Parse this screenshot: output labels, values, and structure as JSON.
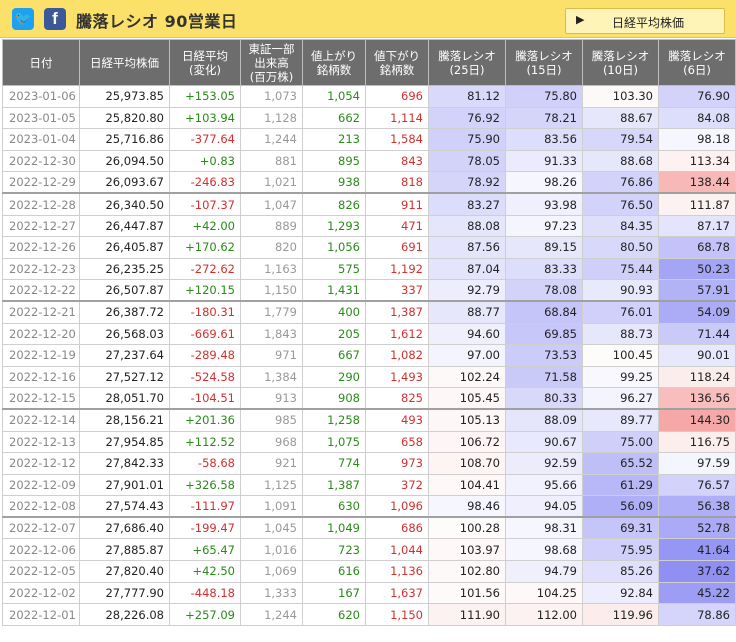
{
  "header": {
    "title": "騰落レシオ 90営業日",
    "nav_button": "日経平均株価",
    "nav_arrow": "▶",
    "twitter_glyph": "🐦",
    "facebook_glyph": "f"
  },
  "columns": [
    [
      "日付"
    ],
    [
      "日経平均株価"
    ],
    [
      "日経平均",
      "(変化)"
    ],
    [
      "東証一部",
      "出来高",
      "(百万株)"
    ],
    [
      "値上がり",
      "銘柄数"
    ],
    [
      "値下がり",
      "銘柄数"
    ],
    [
      "騰落レシオ",
      "(25日)"
    ],
    [
      "騰落レシオ",
      "(15日)"
    ],
    [
      "騰落レシオ",
      "(10日)"
    ],
    [
      "騰落レシオ",
      "(6日)"
    ]
  ],
  "rows": [
    [
      "2023-01-06",
      "25,973.85",
      "+153.05",
      "1,073",
      "1,054",
      "696",
      "81.12",
      "75.80",
      "103.30",
      "76.90"
    ],
    [
      "2023-01-05",
      "25,820.80",
      "+103.94",
      "1,128",
      "662",
      "1,114",
      "76.92",
      "78.21",
      "88.67",
      "84.08"
    ],
    [
      "2023-01-04",
      "25,716.86",
      "-377.64",
      "1,244",
      "213",
      "1,584",
      "75.90",
      "83.56",
      "79.54",
      "98.18"
    ],
    [
      "2022-12-30",
      "26,094.50",
      "+0.83",
      "881",
      "895",
      "843",
      "78.05",
      "91.33",
      "88.68",
      "113.34"
    ],
    [
      "2022-12-29",
      "26,093.67",
      "-246.83",
      "1,021",
      "938",
      "818",
      "78.92",
      "98.26",
      "76.86",
      "138.44"
    ],
    [
      "2022-12-28",
      "26,340.50",
      "-107.37",
      "1,047",
      "826",
      "911",
      "83.27",
      "93.98",
      "76.50",
      "111.87"
    ],
    [
      "2022-12-27",
      "26,447.87",
      "+42.00",
      "889",
      "1,293",
      "471",
      "88.08",
      "97.23",
      "84.35",
      "87.17"
    ],
    [
      "2022-12-26",
      "26,405.87",
      "+170.62",
      "820",
      "1,056",
      "691",
      "87.56",
      "89.15",
      "80.50",
      "68.78"
    ],
    [
      "2022-12-23",
      "26,235.25",
      "-272.62",
      "1,163",
      "575",
      "1,192",
      "87.04",
      "83.33",
      "75.44",
      "50.23"
    ],
    [
      "2022-12-22",
      "26,507.87",
      "+120.15",
      "1,150",
      "1,431",
      "337",
      "92.79",
      "78.08",
      "90.93",
      "57.91"
    ],
    [
      "2022-12-21",
      "26,387.72",
      "-180.31",
      "1,779",
      "400",
      "1,387",
      "88.77",
      "68.84",
      "76.01",
      "54.09"
    ],
    [
      "2022-12-20",
      "26,568.03",
      "-669.61",
      "1,843",
      "205",
      "1,612",
      "94.60",
      "69.85",
      "88.73",
      "71.44"
    ],
    [
      "2022-12-19",
      "27,237.64",
      "-289.48",
      "971",
      "667",
      "1,082",
      "97.00",
      "73.53",
      "100.45",
      "90.01"
    ],
    [
      "2022-12-16",
      "27,527.12",
      "-524.58",
      "1,384",
      "290",
      "1,493",
      "102.24",
      "71.58",
      "99.25",
      "118.24"
    ],
    [
      "2022-12-15",
      "28,051.70",
      "-104.51",
      "913",
      "908",
      "825",
      "105.45",
      "80.33",
      "96.27",
      "136.56"
    ],
    [
      "2022-12-14",
      "28,156.21",
      "+201.36",
      "985",
      "1,258",
      "493",
      "105.13",
      "88.09",
      "89.77",
      "144.30"
    ],
    [
      "2022-12-13",
      "27,954.85",
      "+112.52",
      "968",
      "1,075",
      "658",
      "106.72",
      "90.67",
      "75.00",
      "116.75"
    ],
    [
      "2022-12-12",
      "27,842.33",
      "-58.68",
      "921",
      "774",
      "973",
      "108.70",
      "92.59",
      "65.52",
      "97.59"
    ],
    [
      "2022-12-09",
      "27,901.01",
      "+326.58",
      "1,125",
      "1,387",
      "372",
      "104.41",
      "95.66",
      "61.29",
      "76.57"
    ],
    [
      "2022-12-08",
      "27,574.43",
      "-111.97",
      "1,091",
      "630",
      "1,096",
      "98.46",
      "94.05",
      "56.09",
      "56.38"
    ],
    [
      "2022-12-07",
      "27,686.40",
      "-199.47",
      "1,045",
      "1,049",
      "686",
      "100.28",
      "98.31",
      "69.31",
      "52.78"
    ],
    [
      "2022-12-06",
      "27,885.87",
      "+65.47",
      "1,016",
      "723",
      "1,044",
      "103.97",
      "98.68",
      "75.95",
      "41.64"
    ],
    [
      "2022-12-05",
      "27,820.40",
      "+42.50",
      "1,069",
      "616",
      "1,136",
      "102.80",
      "94.79",
      "85.26",
      "37.62"
    ],
    [
      "2022-12-02",
      "27,777.90",
      "-448.18",
      "1,333",
      "167",
      "1,637",
      "101.56",
      "104.25",
      "92.84",
      "45.22"
    ],
    [
      "2022-12-01",
      "28,226.08",
      "+257.09",
      "1,244",
      "620",
      "1,150",
      "111.90",
      "112.00",
      "119.96",
      "78.86"
    ]
  ],
  "colors": {
    "header_bg": "#fbe16a",
    "table_header_bg": "#6d6d6d",
    "positive": "#2a8a1a",
    "negative": "#d23030",
    "low_ratio": "#7b7bf0",
    "high_ratio": "#f07878"
  }
}
